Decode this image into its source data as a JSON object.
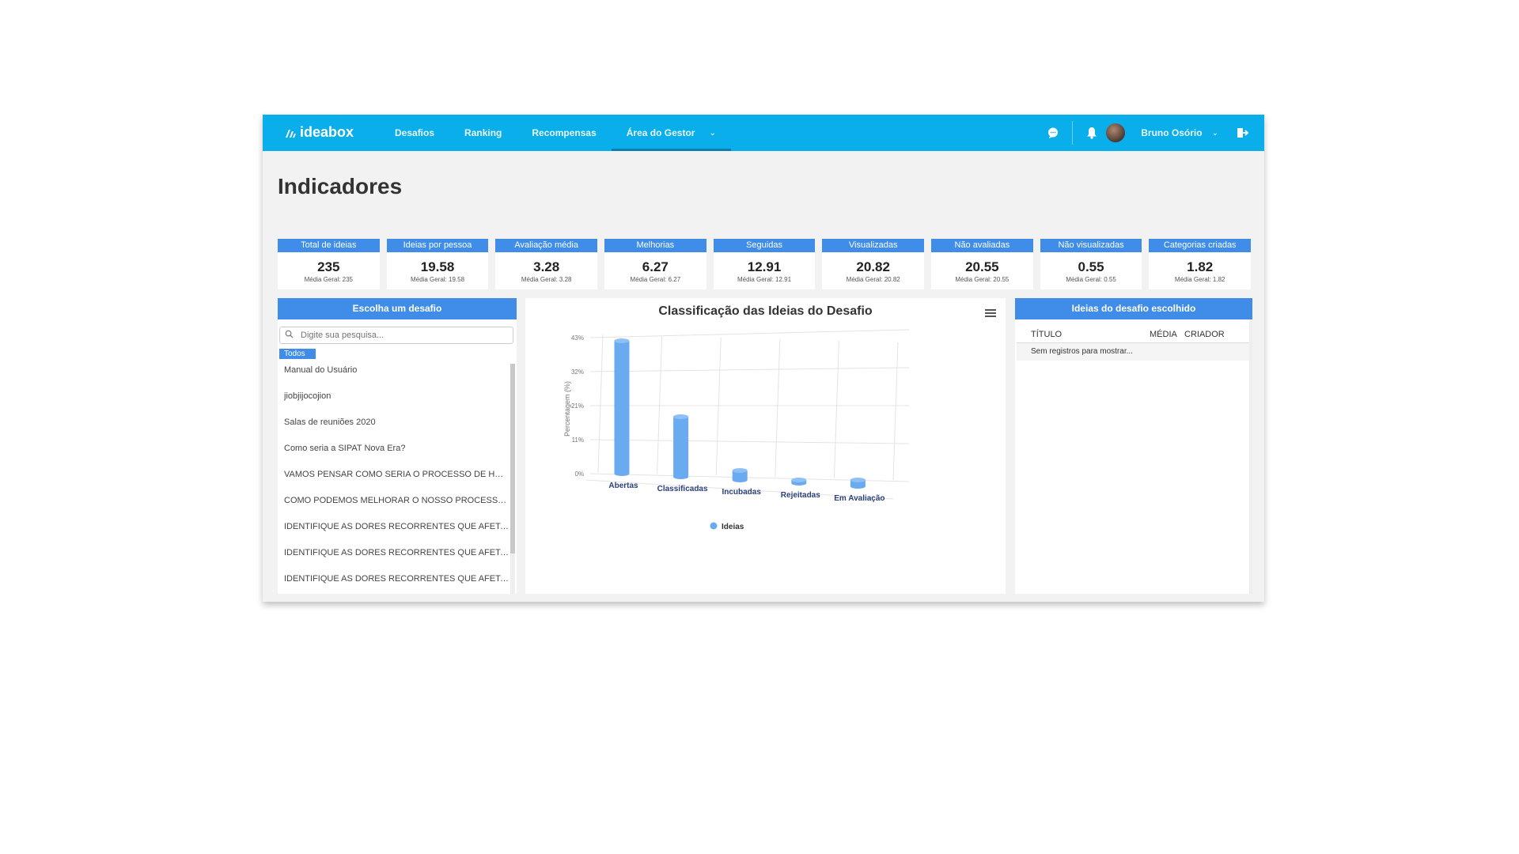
{
  "topbar": {
    "logo_text": "ideabox",
    "nav": [
      {
        "label": "Desafios"
      },
      {
        "label": "Ranking"
      },
      {
        "label": "Recompensas"
      },
      {
        "label": "Área do Gestor"
      }
    ],
    "user_name": "Bruno Osório",
    "icons": [
      "chat-icon",
      "bell-icon",
      "avatar",
      "chevron-down-icon",
      "logout-icon"
    ]
  },
  "page_title": "Indicadores",
  "stats": [
    {
      "label": "Total de ideias",
      "value": "235",
      "sub": "Média Geral: 235"
    },
    {
      "label": "Ideias por pessoa",
      "value": "19.58",
      "sub": "Média Geral: 19.58"
    },
    {
      "label": "Avaliação média",
      "value": "3.28",
      "sub": "Média Geral: 3.28"
    },
    {
      "label": "Melhorias",
      "value": "6.27",
      "sub": "Média Geral: 6.27"
    },
    {
      "label": "Seguidas",
      "value": "12.91",
      "sub": "Média Geral: 12.91"
    },
    {
      "label": "Visualizadas",
      "value": "20.82",
      "sub": "Média Geral: 20.82"
    },
    {
      "label": "Não avaliadas",
      "value": "20.55",
      "sub": "Média Geral: 20.55"
    },
    {
      "label": "Não visualizadas",
      "value": "0.55",
      "sub": "Média Geral: 0.55"
    },
    {
      "label": "Categorias criadas",
      "value": "1.82",
      "sub": "Média Geral: 1.82"
    }
  ],
  "left_panel": {
    "title": "Escolha um desafio",
    "search_placeholder": "Digite sua pesquisa...",
    "chip": "Todos",
    "items": [
      "Manual do Usuário",
      "jiobjijocojion",
      "Salas de reuniões 2020",
      "Como seria a SIPAT Nova Era?",
      "VAMOS PENSAR COMO SERIA O PROCESSO DE HOMOLOGAÇÃO",
      "COMO PODEMOS MELHORAR O NOSSO PROCESSO DE COMPRAS",
      "IDENTIFIQUE AS DORES RECORRENTES QUE AFETAM O CLIENTE",
      "IDENTIFIQUE AS DORES RECORRENTES QUE AFETAM O CLIENTE",
      "IDENTIFIQUE AS DORES RECORRENTES QUE AFETAM O CLIENTE"
    ]
  },
  "center_panel": {
    "menu_icon": "hamburger-menu-icon"
  },
  "chart_data": {
    "type": "bar",
    "title": "Classificação das Ideias do Desafio",
    "ylabel": "Percentagem (%)",
    "xlabel": "",
    "categories": [
      "Abertas",
      "Classificadas",
      "Incubadas",
      "Rejeitadas",
      "Em Avaliação"
    ],
    "series": [
      {
        "name": "Ideias",
        "values": [
          42,
          19,
          3,
          1,
          2
        ],
        "color": "#6aaaf0"
      }
    ],
    "ytick_labels": [
      "0%",
      "11%",
      "21%",
      "32%",
      "43%"
    ],
    "ylim": [
      0,
      43
    ],
    "grid": true,
    "legend": "bottom-center",
    "style": "3d-cylinder"
  },
  "right_panel": {
    "title": "Ideias do desafio escolhido",
    "columns": [
      "TÍTULO",
      "MÉDIA",
      "CRIADOR"
    ],
    "empty_text": "Sem registros para mostrar..."
  },
  "colors": {
    "topbar": "#09aeea",
    "card_header": "#3f8de8",
    "background": "#f2f2f2",
    "bar": "#6aaaf0"
  }
}
